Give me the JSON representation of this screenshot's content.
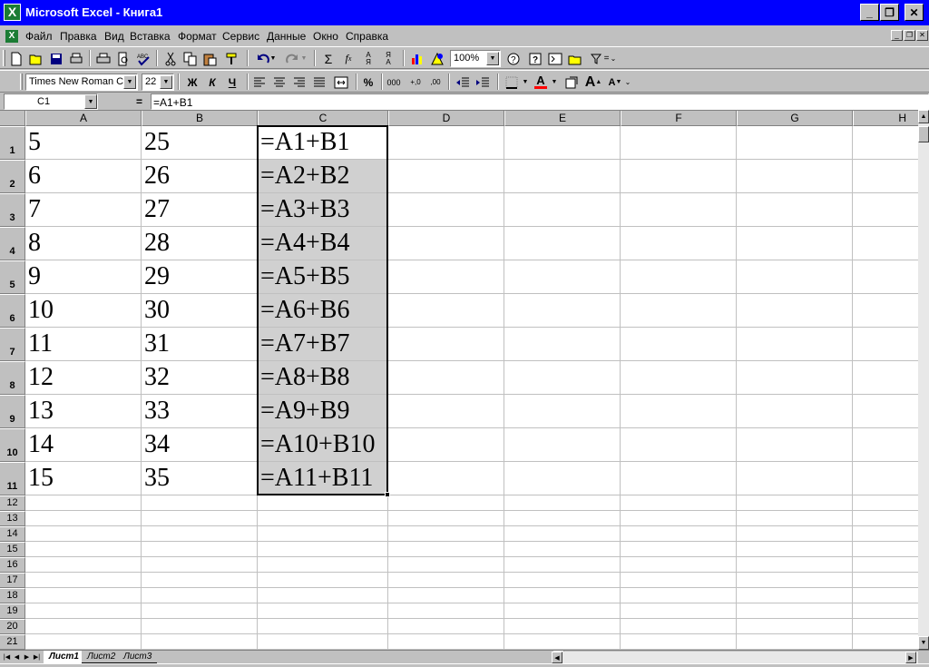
{
  "window": {
    "title": "Microsoft Excel - Книга1",
    "minimize": "_",
    "maximize": "❐",
    "close": "✕",
    "icon": "excel-icon"
  },
  "menu": {
    "items": [
      "Файл",
      "Правка",
      "Вид",
      "Вставка",
      "Формат",
      "Сервис",
      "Данные",
      "Окно",
      "Справка"
    ],
    "doc_minimize": "_",
    "doc_restore": "❐",
    "doc_close": "✕"
  },
  "toolbar_standard": {
    "zoom": "100%"
  },
  "toolbar_format": {
    "font_name": "Times New Roman Cyr",
    "font_size": "22",
    "bold": "Ж",
    "italic": "К",
    "underline": "Ч",
    "percent": "%",
    "thousands": "000",
    "inc_decimal": "+,0",
    "dec_decimal": ",00",
    "font_color_letter": "A",
    "grow_font": "A",
    "shrink_font": "A"
  },
  "formula_bar": {
    "name_box": "C1",
    "eq_sign": "=",
    "formula": "=A1+B1"
  },
  "columns": [
    "A",
    "B",
    "C",
    "D",
    "E",
    "F",
    "G",
    "H"
  ],
  "rows": [
    [
      "5",
      "25",
      "=A1+B1"
    ],
    [
      "6",
      "26",
      "=A2+B2"
    ],
    [
      "7",
      "27",
      "=A3+B3"
    ],
    [
      "8",
      "28",
      "=A4+B4"
    ],
    [
      "9",
      "29",
      "=A5+B5"
    ],
    [
      "10",
      "30",
      "=A6+B6"
    ],
    [
      "11",
      "31",
      "=A7+B7"
    ],
    [
      "12",
      "32",
      "=A8+B8"
    ],
    [
      "13",
      "33",
      "=A9+B9"
    ],
    [
      "14",
      "34",
      "=A10+B10"
    ],
    [
      "15",
      "35",
      "=A11+B11"
    ]
  ],
  "row_numbers": [
    "1",
    "2",
    "3",
    "4",
    "5",
    "6",
    "7",
    "8",
    "9",
    "10",
    "11",
    "12",
    "13",
    "14",
    "15",
    "16",
    "17",
    "18",
    "19",
    "20",
    "21"
  ],
  "sheets": [
    "Лист1",
    "Лист2",
    "Лист3"
  ],
  "active_sheet": "Лист1"
}
